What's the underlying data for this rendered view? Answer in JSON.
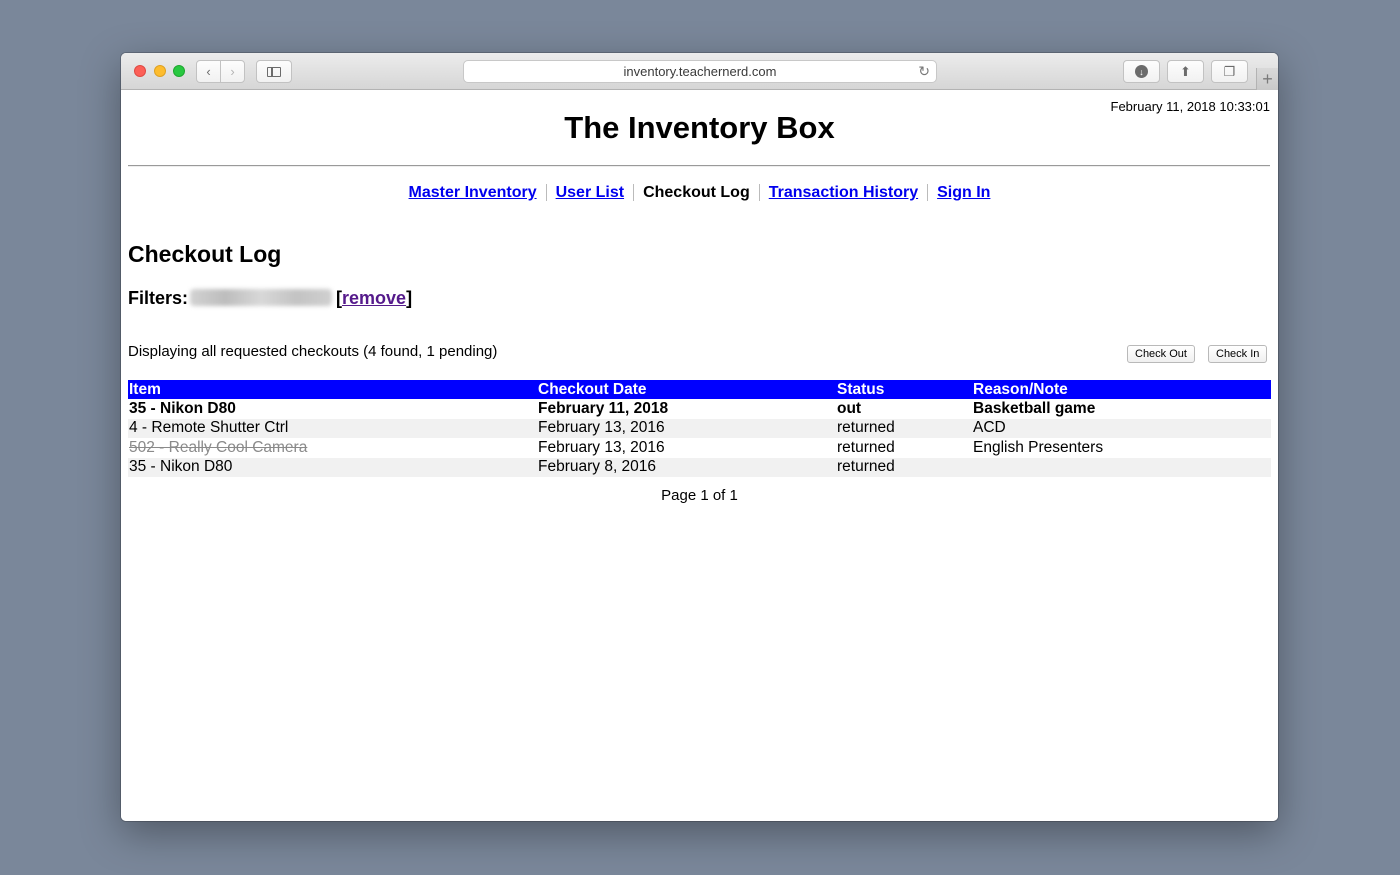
{
  "browser": {
    "url": "inventory.teachernerd.com"
  },
  "clock": "February 11, 2018 10:33:01",
  "site_title": "The Inventory Box",
  "nav": [
    {
      "label": "Master Inventory"
    },
    {
      "label": "User List"
    },
    {
      "label": "Checkout Log"
    },
    {
      "label": "Transaction History"
    },
    {
      "label": "Sign In"
    }
  ],
  "heading": "Checkout Log",
  "filters": {
    "label": "Filters:",
    "remove_label": "remove"
  },
  "summary": "Displaying all requested checkouts (4 found, 1 pending)",
  "actions": {
    "check_out": "Check Out",
    "check_in": "Check In"
  },
  "table": {
    "headers": [
      "Item",
      "Checkout Date",
      "Status",
      "Reason/Note"
    ],
    "rows": [
      {
        "item": "35 - Nikon D80",
        "date": "February 11, 2018",
        "status": "out",
        "note": "Basketball game"
      },
      {
        "item": "4 - Remote Shutter Ctrl",
        "date": "February 13, 2016",
        "status": "returned",
        "note": "ACD"
      },
      {
        "item": "502 - Really Cool Camera",
        "date": "February 13, 2016",
        "status": "returned",
        "note": "English Presenters"
      },
      {
        "item": "35 - Nikon D80",
        "date": "February 8, 2016",
        "status": "returned",
        "note": ""
      }
    ]
  },
  "pager": "Page 1 of 1"
}
